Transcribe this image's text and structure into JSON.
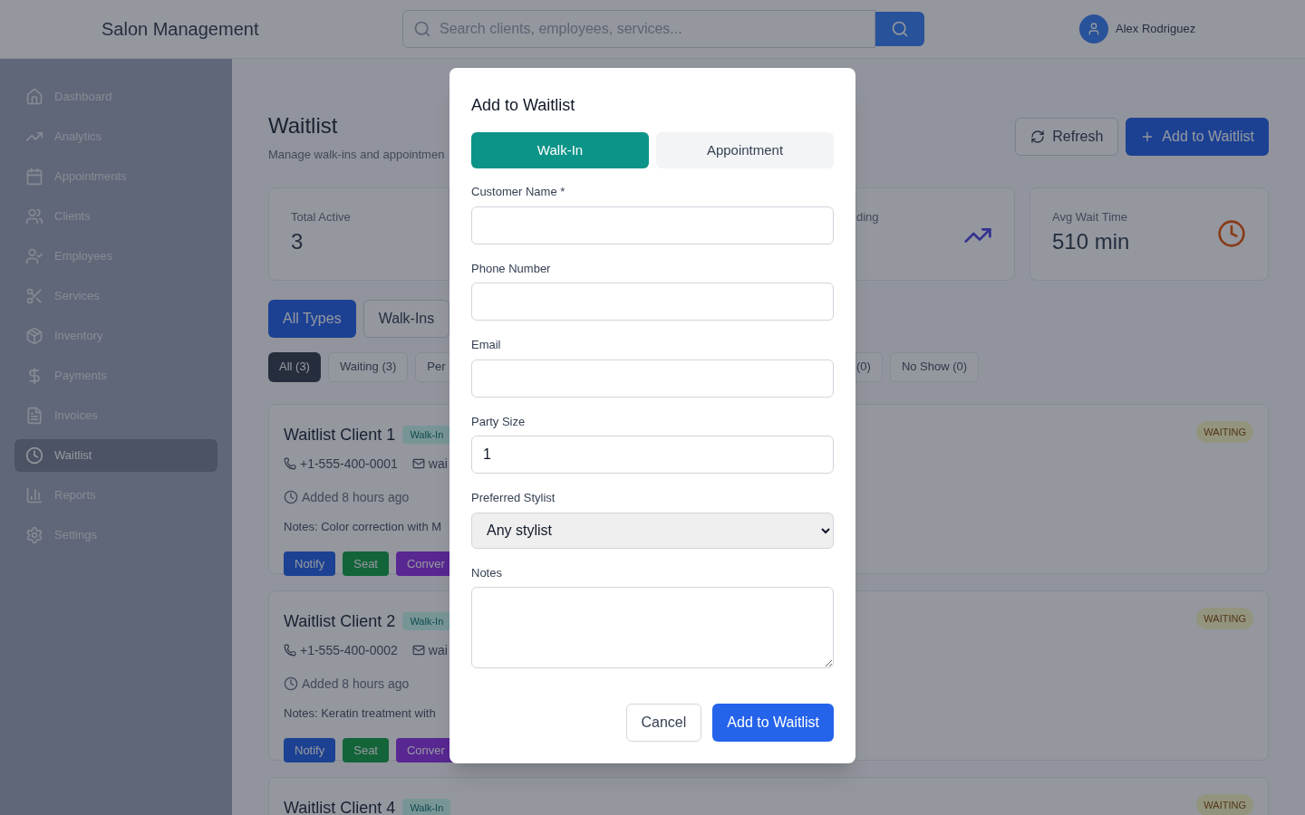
{
  "header": {
    "title": "Salon Management",
    "search_placeholder": "Search clients, employees, services...",
    "user_name": "Alex Rodriguez"
  },
  "sidebar": {
    "items": [
      {
        "label": "Dashboard",
        "selected": false
      },
      {
        "label": "Analytics",
        "selected": false
      },
      {
        "label": "Appointments",
        "selected": false
      },
      {
        "label": "Clients",
        "selected": false
      },
      {
        "label": "Employees",
        "selected": false
      },
      {
        "label": "Services",
        "selected": false
      },
      {
        "label": "Inventory",
        "selected": false
      },
      {
        "label": "Payments",
        "selected": false
      },
      {
        "label": "Invoices",
        "selected": false
      },
      {
        "label": "Waitlist",
        "selected": true
      },
      {
        "label": "Reports",
        "selected": false
      },
      {
        "label": "Settings",
        "selected": false
      }
    ]
  },
  "page": {
    "title": "Waitlist",
    "subtitle": "Manage walk-ins and appointmen",
    "actions": [
      "Refresh",
      "Add to Waitlist"
    ]
  },
  "stats": [
    {
      "label": "Total Active",
      "value": "3"
    },
    {
      "label": "ding"
    },
    {
      "label": "Avg Wait Time",
      "value": "510 min"
    }
  ],
  "type_tabs": [
    {
      "label": "All Types",
      "selected": true
    },
    {
      "label": "Walk-Ins",
      "selected": false
    }
  ],
  "status_filters_left": [
    {
      "label": "All (3)",
      "selected": true
    },
    {
      "label": "Waiting (3)",
      "selected": false
    },
    {
      "label": "Per",
      "selected": false
    }
  ],
  "status_filters_right": [
    {
      "label": "(0)",
      "selected": false
    },
    {
      "label": "No Show (0)",
      "selected": false
    }
  ],
  "entries": [
    {
      "name": "Waitlist Client 1",
      "type": "Walk-In",
      "phone": "+1-555-400-0001",
      "email": "wai",
      "added": "Added 8 hours ago",
      "notes": "Notes: Color correction with M",
      "status": "WAITING",
      "buttons": [
        "Notify",
        "Seat",
        "Conver"
      ]
    },
    {
      "name": "Waitlist Client 2",
      "type": "Walk-In",
      "phone": "+1-555-400-0002",
      "email": "wai",
      "added": "Added 8 hours ago",
      "notes": "Notes: Keratin treatment with",
      "status": "WAITING",
      "buttons": [
        "Notify",
        "Seat",
        "Conver"
      ]
    },
    {
      "name": "Waitlist Client 4",
      "type": "Walk-In",
      "status": "WAITING"
    }
  ],
  "dialog": {
    "title": "Add to Waitlist",
    "tabs": [
      {
        "label": "Walk-In",
        "selected": true
      },
      {
        "label": "Appointment",
        "selected": false
      }
    ],
    "fields": [
      {
        "label": "Customer Name *",
        "kind": "text"
      },
      {
        "label": "Phone Number",
        "kind": "text"
      },
      {
        "label": "Email",
        "kind": "text"
      },
      {
        "label": "Party Size",
        "kind": "text",
        "value": "1"
      },
      {
        "label": "Preferred Stylist",
        "kind": "select",
        "value": "Any stylist"
      },
      {
        "label": "Notes",
        "kind": "textarea"
      }
    ],
    "buttons": [
      "Cancel",
      "Add to Waitlist"
    ]
  }
}
